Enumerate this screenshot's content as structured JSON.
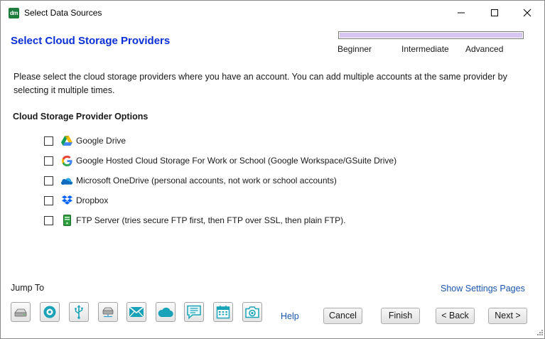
{
  "window": {
    "title": "Select Data Sources",
    "app_icon_text": "dm"
  },
  "header": {
    "title": "Select Cloud Storage Providers",
    "levels": [
      "Beginner",
      "Intermediate",
      "Advanced"
    ],
    "level_fill_fraction": 1.0,
    "level_fill_color": "#d8c6f2"
  },
  "description": "Please select the cloud storage providers where you have an account. You can add multiple accounts at the same provider by selecting it multiple times.",
  "options_section": {
    "heading": "Cloud Storage Provider Options",
    "items": [
      {
        "label": "Google Drive",
        "icon": "google-drive-icon",
        "checked": false
      },
      {
        "label": "Google Hosted Cloud Storage For Work or School (Google Workspace/GSuite Drive)",
        "icon": "google-g-icon",
        "checked": false
      },
      {
        "label": "Microsoft OneDrive (personal accounts, not work or school accounts)",
        "icon": "onedrive-cloud-icon",
        "checked": false
      },
      {
        "label": "Dropbox",
        "icon": "dropbox-icon",
        "checked": false
      },
      {
        "label": "FTP Server (tries secure FTP first, then FTP over SSL, then plain FTP).",
        "icon": "ftp-server-icon",
        "checked": false
      }
    ]
  },
  "footer": {
    "jump_to_label": "Jump To",
    "show_settings_label": "Show Settings Pages",
    "jump_buttons": [
      "drive-icon",
      "disc-icon",
      "usb-icon",
      "network-drive-icon",
      "email-icon",
      "cloud-icon",
      "message-icon",
      "calendar-icon",
      "camera-icon"
    ],
    "help_label": "Help",
    "cancel_label": "Cancel",
    "finish_label": "Finish",
    "back_label": "< Back",
    "next_label": "Next >"
  },
  "colors": {
    "title_blue": "#0a2fd6",
    "link_blue": "#1a56b0",
    "jump_icon_teal": "#1aa3b8"
  }
}
